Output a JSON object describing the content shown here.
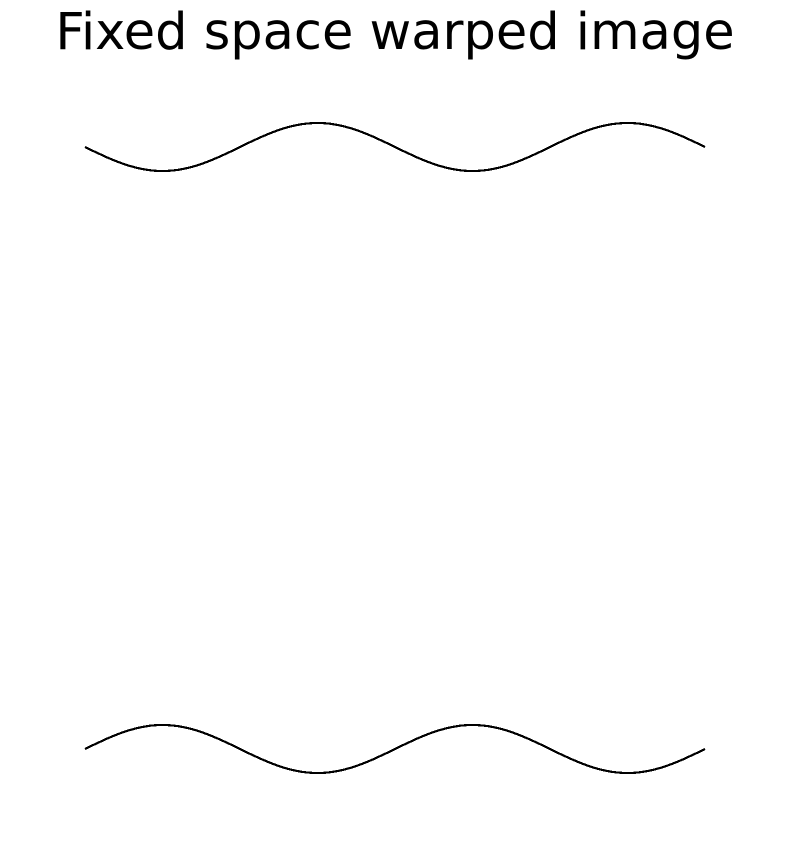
{
  "figure": {
    "title": "Fixed space warped image"
  },
  "colors": {
    "background": "#ffffff",
    "line": "#000000"
  }
}
